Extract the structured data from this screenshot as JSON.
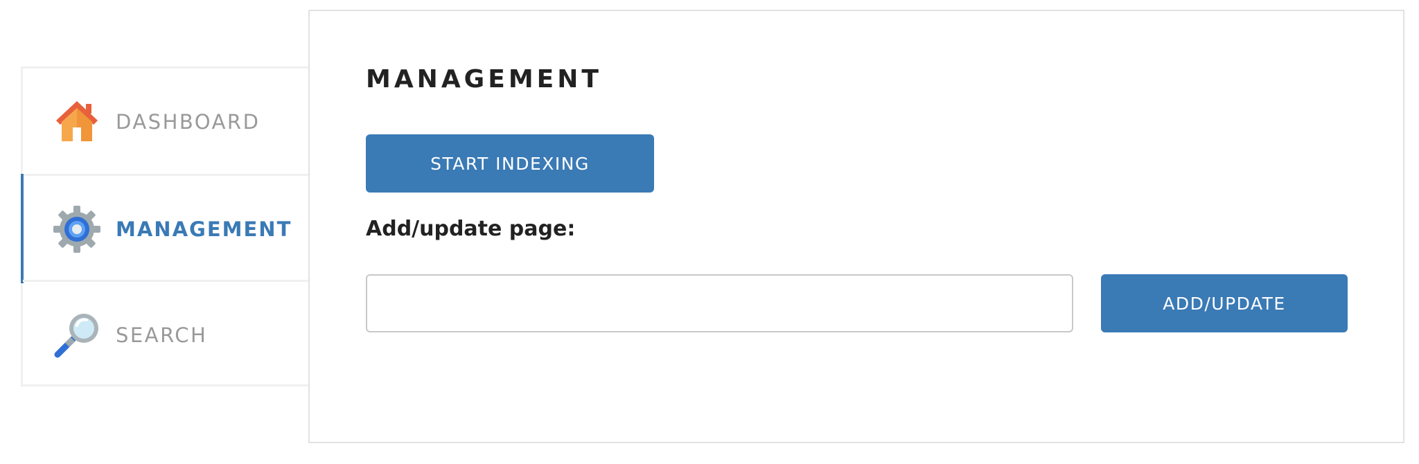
{
  "sidebar": {
    "items": [
      {
        "label": "DASHBOARD",
        "icon": "house-icon",
        "active": false
      },
      {
        "label": "MANAGEMENT",
        "icon": "gear-icon",
        "active": true
      },
      {
        "label": "SEARCH",
        "icon": "magnifier-icon",
        "active": false
      }
    ]
  },
  "main": {
    "title": "MANAGEMENT",
    "start_indexing_label": "START INDEXING",
    "add_update_field_label": "Add/update page:",
    "add_update_input_value": "",
    "add_update_input_placeholder": "",
    "add_update_button_label": "ADD/UPDATE"
  },
  "colors": {
    "accent": "#3a7ab5",
    "inactive_text": "#999999",
    "heading_text": "#222222",
    "border": "#e2e2e2"
  }
}
